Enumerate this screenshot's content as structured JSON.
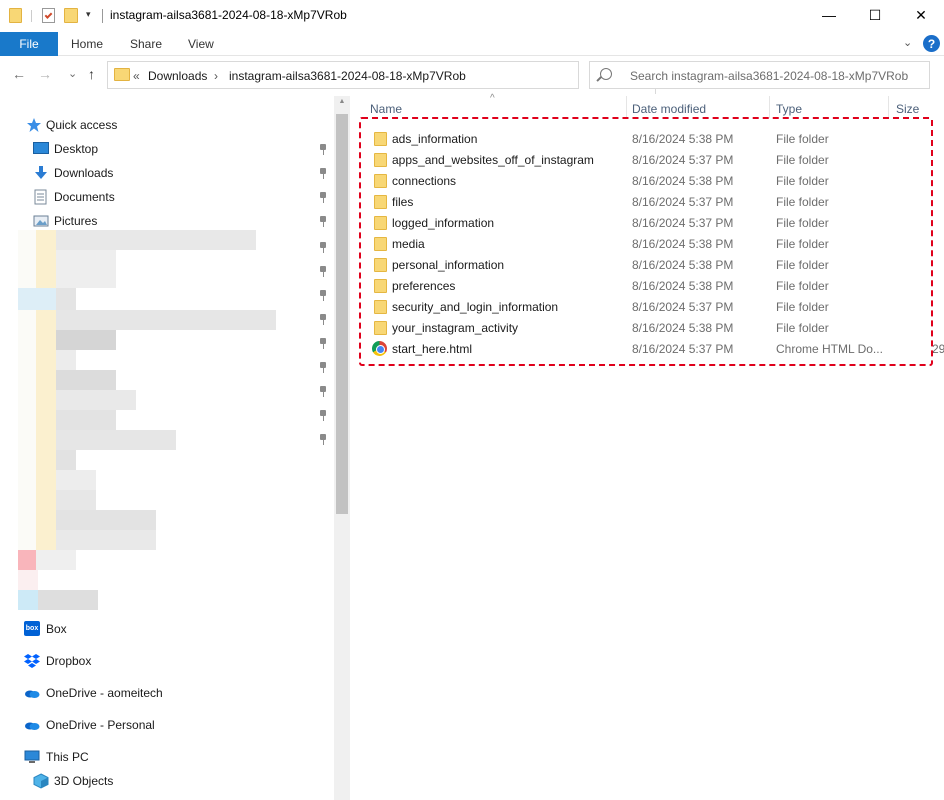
{
  "window": {
    "title": "instagram-ailsa3681-2024-08-18-xMp7VRob",
    "minimize": "—",
    "maximize": "☐",
    "close": "✕"
  },
  "ribbon": {
    "tabs": [
      "File",
      "Home",
      "Share",
      "View"
    ],
    "expand": "⌄",
    "help": "?"
  },
  "address": {
    "back": "←",
    "forward": "→",
    "recent": "⌄",
    "up": "↑",
    "overflow": "«",
    "crumbs": [
      "Downloads",
      "instagram-ailsa3681-2024-08-18-xMp7VRob"
    ],
    "separator": "›",
    "refresh": "↻",
    "dropdown": "⌄"
  },
  "search": {
    "placeholder": "Search instagram-ailsa3681-2024-08-18-xMp7VRob"
  },
  "nav": {
    "quick_access": "Quick access",
    "pinned": [
      {
        "label": "Desktop",
        "icon": "desktop-icon"
      },
      {
        "label": "Downloads",
        "icon": "downloads-icon"
      },
      {
        "label": "Documents",
        "icon": "documents-icon"
      },
      {
        "label": "Pictures",
        "icon": "pictures-icon"
      }
    ],
    "locations": [
      {
        "label": "Box",
        "icon": "box-icon"
      },
      {
        "label": "Dropbox",
        "icon": "dropbox-icon"
      },
      {
        "label": "OneDrive - aomeitech",
        "icon": "onedrive-icon"
      },
      {
        "label": "OneDrive - Personal",
        "icon": "onedrive-icon"
      },
      {
        "label": "This PC",
        "icon": "this-pc-icon"
      },
      {
        "label": "3D Objects",
        "icon": "3d-objects-icon"
      }
    ]
  },
  "columns": {
    "name": "Name",
    "date": "Date modified",
    "type": "Type",
    "size": "Size"
  },
  "files": [
    {
      "name": "ads_information",
      "date": "8/16/2024 5:38 PM",
      "type": "File folder",
      "size": "",
      "kind": "folder"
    },
    {
      "name": "apps_and_websites_off_of_instagram",
      "date": "8/16/2024 5:37 PM",
      "type": "File folder",
      "size": "",
      "kind": "folder"
    },
    {
      "name": "connections",
      "date": "8/16/2024 5:38 PM",
      "type": "File folder",
      "size": "",
      "kind": "folder"
    },
    {
      "name": "files",
      "date": "8/16/2024 5:37 PM",
      "type": "File folder",
      "size": "",
      "kind": "folder"
    },
    {
      "name": "logged_information",
      "date": "8/16/2024 5:37 PM",
      "type": "File folder",
      "size": "",
      "kind": "folder"
    },
    {
      "name": "media",
      "date": "8/16/2024 5:38 PM",
      "type": "File folder",
      "size": "",
      "kind": "folder"
    },
    {
      "name": "personal_information",
      "date": "8/16/2024 5:38 PM",
      "type": "File folder",
      "size": "",
      "kind": "folder"
    },
    {
      "name": "preferences",
      "date": "8/16/2024 5:38 PM",
      "type": "File folder",
      "size": "",
      "kind": "folder"
    },
    {
      "name": "security_and_login_information",
      "date": "8/16/2024 5:37 PM",
      "type": "File folder",
      "size": "",
      "kind": "folder"
    },
    {
      "name": "your_instagram_activity",
      "date": "8/16/2024 5:38 PM",
      "type": "File folder",
      "size": "",
      "kind": "folder"
    },
    {
      "name": "start_here.html",
      "date": "8/16/2024 5:37 PM",
      "type": "Chrome HTML Do...",
      "size": "29",
      "kind": "chrome"
    }
  ],
  "colors": {
    "accent": "#1979ca",
    "highlight": "#e0001b",
    "folder": "#f8d775"
  }
}
